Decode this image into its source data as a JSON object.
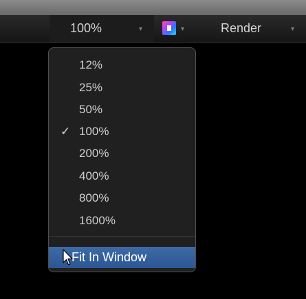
{
  "toolbar": {
    "zoom_value": "100%",
    "zoom_arrow": "▾",
    "view_options_icon": "color-view-icon",
    "view_arrow": "▾",
    "render_label": "Render",
    "render_arrow": "▾"
  },
  "menu": {
    "items": [
      {
        "label": "12%"
      },
      {
        "label": "25%"
      },
      {
        "label": "50%"
      },
      {
        "label": "100%"
      },
      {
        "label": "200%"
      },
      {
        "label": "400%"
      },
      {
        "label": "800%"
      },
      {
        "label": "1600%"
      }
    ],
    "checkmark": "✓",
    "fit_label": "Fit In Window",
    "selected_color": "#2f5c9a"
  }
}
